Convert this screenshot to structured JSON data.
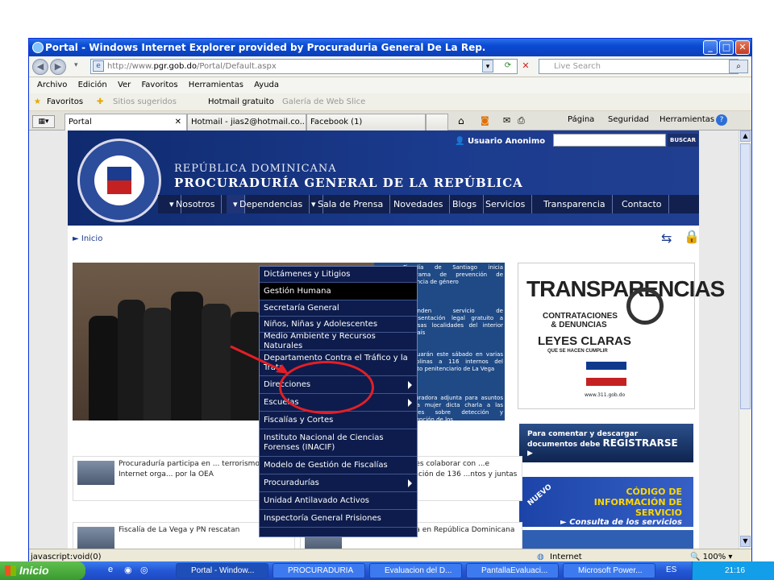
{
  "window": {
    "title": "Portal - Windows Internet Explorer provided by Procuraduria General De La Rep."
  },
  "address": {
    "url_prefix": "http://www.",
    "url_host": "pgr.gob.do",
    "url_path": "/Portal/Default.aspx",
    "search_placeholder": "Live Search"
  },
  "menubar": [
    "Archivo",
    "Edición",
    "Ver",
    "Favoritos",
    "Herramientas",
    "Ayuda"
  ],
  "favbar": {
    "favorites": "Favoritos",
    "suggested": "Sitios sugeridos",
    "hotmail": "Hotmail gratuito",
    "gallery": "Galería de Web Slice"
  },
  "tabs": [
    {
      "label": "Portal"
    },
    {
      "label": "Hotmail - jias2@hotmail.co..."
    },
    {
      "label": "Facebook (1)"
    }
  ],
  "toolbar": {
    "page": "Página",
    "security": "Seguridad",
    "tools": "Herramientas"
  },
  "site": {
    "line1": "REPÚBLICA DOMINICANA",
    "line2": "PROCURADURÍA GENERAL DE LA REPÚBLICA",
    "user": "Usuario Anonimo",
    "search_btn": "BUSCAR",
    "nav": [
      "Nosotros",
      "Dependencias",
      "Sala de Prensa",
      "Novedades",
      "Blogs",
      "Servicios",
      "Transparencia",
      "Contacto"
    ],
    "breadcrumb": "► Inicio"
  },
  "dropdown": [
    {
      "label": "Dictámenes y Litigios"
    },
    {
      "label": "Gestión Humana"
    },
    {
      "label": "Secretaría General"
    },
    {
      "label": "Niños, Niñas y Adolescentes"
    },
    {
      "label": "Medio Ambiente y Recursos Naturales"
    },
    {
      "label": "Departamento Contra el Tráfico y la Trata"
    },
    {
      "label": "Direcciones"
    },
    {
      "label": "Escuelas"
    },
    {
      "label": "Fiscalías y Cortes"
    },
    {
      "label": "Instituto Nacional de Ciencias Forenses (INACIF)"
    },
    {
      "label": "Modelo de Gestión de Fiscalías"
    },
    {
      "label": "Procuradurías"
    },
    {
      "label": "Unidad Antilavado Activos"
    },
    {
      "label": "Inspectoría General Prisiones"
    }
  ],
  "news": [
    "Fiscalía de Santiago inicia programa de prevención de violencia de género",
    "Extienden servicio de representación legal gratuito a diversas localidades del interior del país",
    "Graduarán este sábado en varias disciplinas a 116 internos del recinto penitenciario de La Vega",
    "Procuradora adjunta para asuntos de la mujer dicta charla a las madres sobre detección y prevención de los ..."
  ],
  "transparency": {
    "big": "TRANSPARENCIAS",
    "mid": "CONTRATACIONES & DENUNCIAS",
    "leyes": "LEYES CLARAS",
    "small": "QUE SE HACEN CUMPLIR",
    "url": "www.311.gob.do"
  },
  "banner1": {
    "text": "Para comentar y descargar documentos debe",
    "cta": "REGISTRARSE"
  },
  "banner2": {
    "nuevo": "NUEVO",
    "l1": "CÓDIGO DE",
    "l2": "INFORMACIÓN DE SERVICIO",
    "l3": "► Consulta de los servicios"
  },
  "lower_news": [
    "Procuraduría participa en ... terrorismo vía Internet orga... por la OEA",
    "...r instruye a fiscales colaborar con ...e Cuentas en fiscalización de 136 ...ntos y juntas de distritos",
    "Fiscalía de La Vega y PN rescatan",
    "Embajador de Corea en República Dominicana"
  ],
  "status": {
    "left": "javascript:void(0)",
    "zone": "Internet",
    "zoom": "100%"
  },
  "taskbar": {
    "start": "Inicio",
    "buttons": [
      "Portal - Window...",
      "PROCURADURIA",
      "Evaluacion del D...",
      "PantallaEvaluaci...",
      "Microsoft Power..."
    ],
    "lang": "ES",
    "clock": "21:16"
  }
}
